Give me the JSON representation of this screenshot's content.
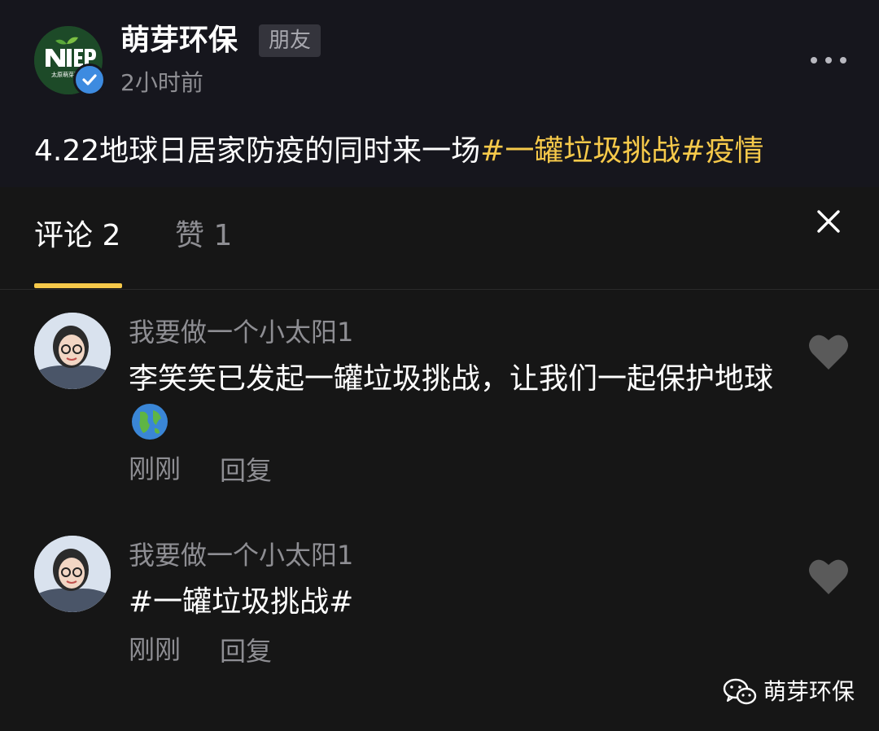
{
  "post": {
    "author": "萌芽环保",
    "badge": "朋友",
    "time": "2小时前",
    "text_plain": "4.22地球日居家防疫的同时来一场",
    "text_tags": "#一罐垃圾挑战#疫情",
    "logo_text": "NIEP",
    "logo_sub": "太原萌芽环保",
    "accent_color": "#f6c94a"
  },
  "tabs": {
    "comments_label": "评论 2",
    "likes_label": "赞 1"
  },
  "comments": [
    {
      "author": "我要做一个小太阳1",
      "text": "李笑笑已发起一罐垃圾挑战，让我们一起保护地球",
      "emoji": "earth-globe-icon",
      "time": "刚刚",
      "reply_label": "回复"
    },
    {
      "author": "我要做一个小太阳1",
      "text": "#一罐垃圾挑战#",
      "time": "刚刚",
      "reply_label": "回复"
    }
  ],
  "watermark": {
    "text": "萌芽环保",
    "icon": "wechat-icon"
  }
}
